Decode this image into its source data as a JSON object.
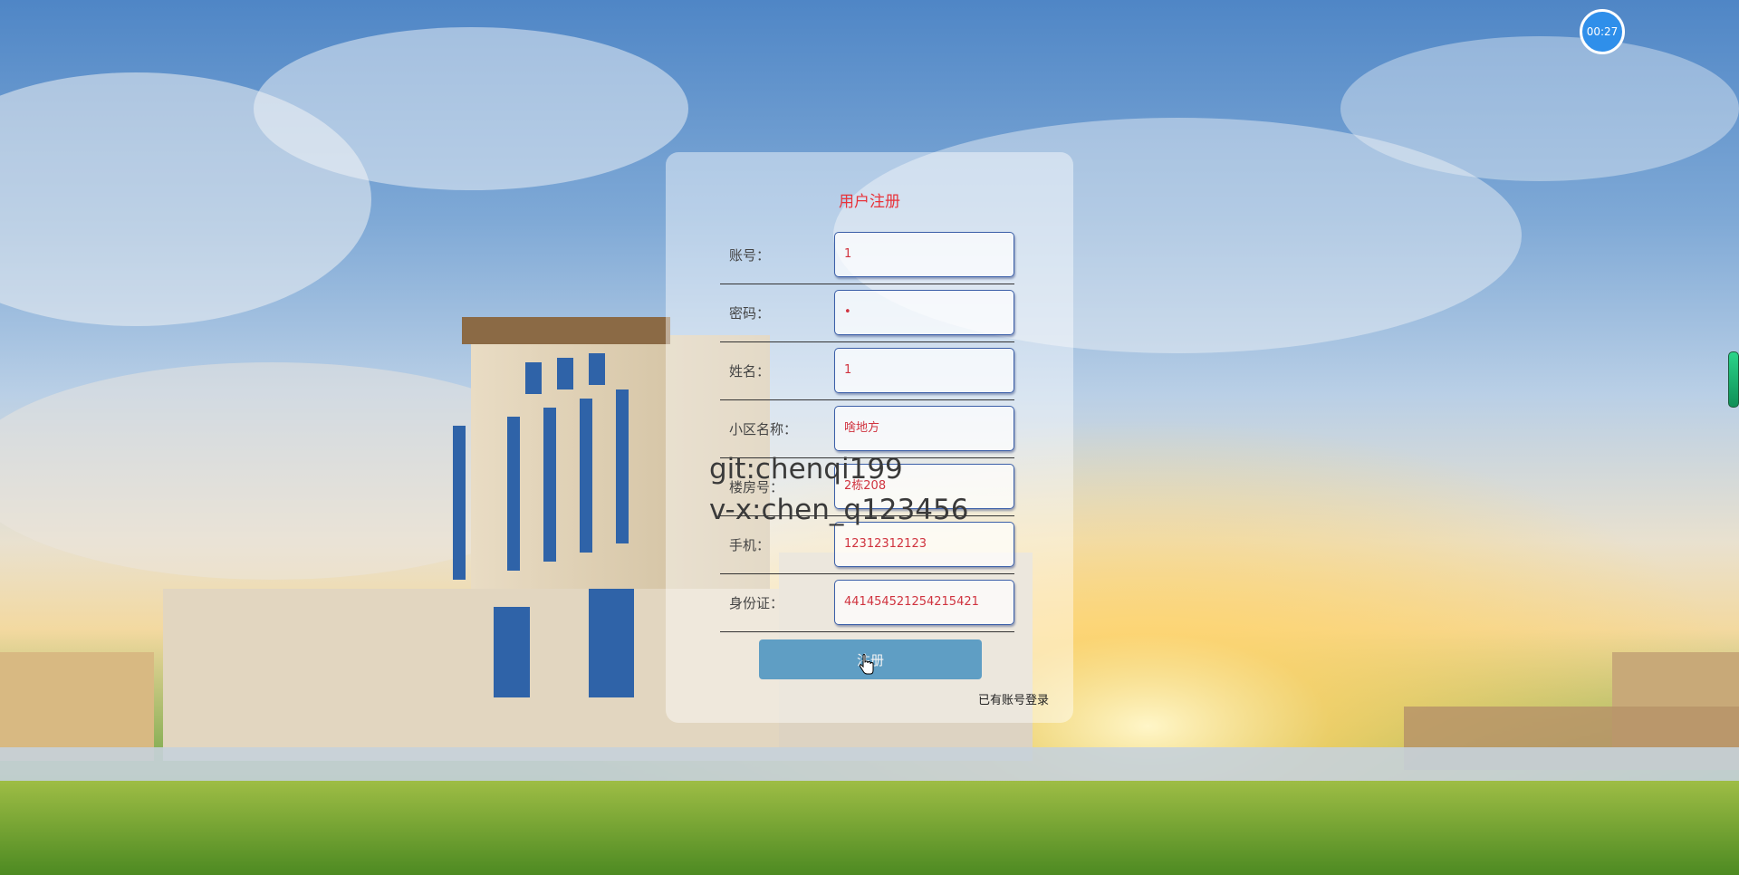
{
  "timer": {
    "text": "00:27"
  },
  "form": {
    "title": "用户注册",
    "fields": [
      {
        "label": "账号：",
        "value": "1"
      },
      {
        "label": "密码：",
        "value": "•"
      },
      {
        "label": "姓名：",
        "value": "1"
      },
      {
        "label": "小区名称：",
        "value": "啥地方"
      },
      {
        "label": "楼房号：",
        "value": "2栋208"
      },
      {
        "label": "手机：",
        "value": "12312312123"
      },
      {
        "label": "身份证：",
        "value": "441454521254215421"
      }
    ],
    "submit_label": "注册",
    "login_link": "已有账号登录"
  },
  "watermark": {
    "line1": "git:chenqi199",
    "line2": "v-x:chen_q123456"
  },
  "colors": {
    "title": "#e8333a",
    "input_text": "#d0333f",
    "button": "#5f9ec4",
    "timer": "#2f8fea"
  }
}
